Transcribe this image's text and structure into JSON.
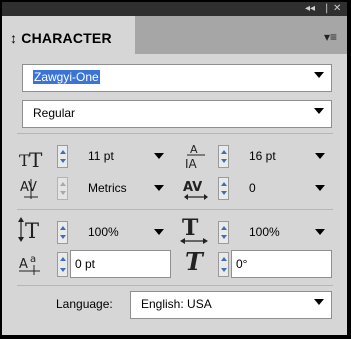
{
  "panel": {
    "title": "CHARACTER",
    "title_glyph": "↕",
    "controls": {
      "collapse": "◂◂",
      "divider": "|",
      "close": "✕"
    },
    "menu": "▾≡"
  },
  "font_family": {
    "value": "Zawgyi-One"
  },
  "font_style": {
    "value": "Regular"
  },
  "font_size": {
    "value": "11 pt"
  },
  "leading": {
    "value": "16 pt"
  },
  "kerning": {
    "value": "Metrics"
  },
  "tracking": {
    "value": "0"
  },
  "vertical_scale": {
    "value": "100%"
  },
  "horizontal_scale": {
    "value": "100%"
  },
  "baseline_shift": {
    "value": "0 pt"
  },
  "skew": {
    "value": "0°"
  },
  "language": {
    "label": "Language:",
    "value": "English: USA"
  },
  "icons": {
    "font_size": "TT",
    "leading": "A/A",
    "kerning": "AV",
    "tracking": "AV",
    "vertical_scale": "IT",
    "horizontal_scale": "T",
    "baseline_shift": "Aa",
    "skew": "T"
  },
  "colors": {
    "panel_bg": "#d6d6d6",
    "tab_strip": "#a6a6a6",
    "selection": "#3a74d8",
    "spinner_arrow": "#3c6fb8",
    "title_bar": "#2f2f2f"
  }
}
